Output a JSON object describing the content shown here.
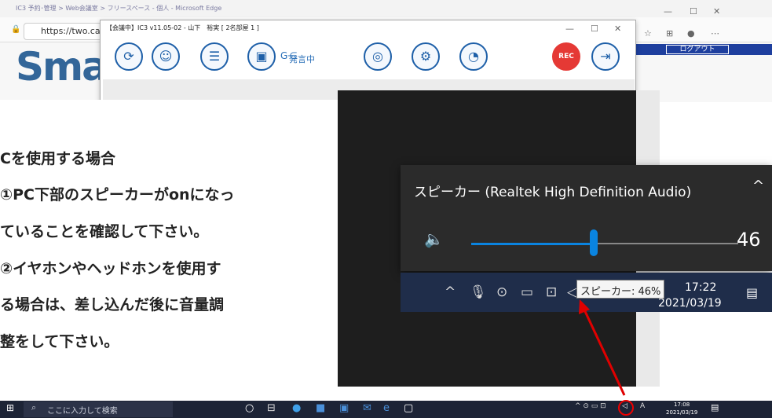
{
  "browser": {
    "title": "IC3 予約･管理 > Web会議室 > フリースペース - 個人 - Microsoft Edge",
    "address": "https://two.careca",
    "page_logo": "Sma",
    "logout_label": "ログアウト",
    "window_controls": [
      "—",
      "☐",
      "✕"
    ]
  },
  "ic3_window": {
    "title": "【会議中】IC3 v11.05-02 - 山下　裕実 [ 2名部屋 1 ]",
    "speaking_label": "発言中",
    "rec_label": "REC",
    "toolbar_icons": [
      "camera-switch-icon",
      "participants-icon",
      "chat-icon",
      "profile-icon",
      "speaking-icon",
      "zoom-icon",
      "settings-icon",
      "meter-icon",
      "rec-icon",
      "exit-icon"
    ]
  },
  "note": {
    "lines": [
      "Cを使用する場合",
      "①PC下部のスピーカーがonになっ",
      "ていることを確認して下さい。",
      "②イヤホンやヘッドホンを使用す",
      "る場合は、差し込んだ後に音量調",
      "整をして下さい。"
    ]
  },
  "flyout": {
    "title": "スピーカー (Realtek High Definition Audio)",
    "volume_value": "46",
    "volume_fraction": 0.46
  },
  "zoom_taskbar": {
    "tooltip": "スピーカー: 46%",
    "time": "17:22",
    "date": "2021/03/19"
  },
  "taskbar": {
    "search_placeholder": "ここに入力して検索",
    "time": "17:08",
    "date": "2021/03/19"
  },
  "colors": {
    "accent_blue": "#1d5fa8",
    "rec_red": "#e53935",
    "arrow_red": "#e00000",
    "slider_blue": "#0a84e0"
  }
}
